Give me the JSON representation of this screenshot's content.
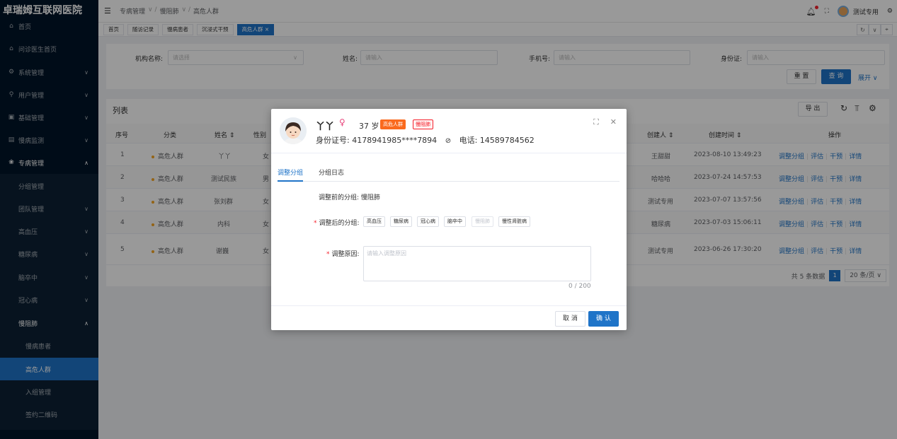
{
  "app": {
    "title": "卓瑞姆互联网医院"
  },
  "sidebar": {
    "items": [
      {
        "label": "首页",
        "icon": "home-icon"
      },
      {
        "label": "问诊医生首页",
        "icon": "home-icon"
      },
      {
        "label": "系统管理",
        "icon": "gear-icon"
      },
      {
        "label": "用户管理",
        "icon": "user-icon"
      },
      {
        "label": "基础管理",
        "icon": "grid-icon"
      },
      {
        "label": "慢病监测",
        "icon": "grid-icon"
      },
      {
        "label": "专病管理",
        "icon": "asterisk-icon"
      },
      {
        "label": "分组管理"
      },
      {
        "label": "团队管理"
      },
      {
        "label": "高血压"
      },
      {
        "label": "糖尿病"
      },
      {
        "label": "脑卒中"
      },
      {
        "label": "冠心病"
      },
      {
        "label": "慢阻肺"
      },
      {
        "label": "慢病患者"
      },
      {
        "label": "高危人群"
      },
      {
        "label": "入组管理"
      },
      {
        "label": "签约二维码"
      }
    ]
  },
  "header": {
    "breadcrumb": [
      "专病管理",
      "慢阻肺",
      "高危人群"
    ],
    "user_name": "测试专用"
  },
  "tabs": [
    {
      "label": "首页"
    },
    {
      "label": "随访记录"
    },
    {
      "label": "慢病患者"
    },
    {
      "label": "沉浸式干预"
    },
    {
      "label": "高危人群 ×"
    }
  ],
  "filter": {
    "org_label": "机构名称:",
    "org_placeholder": "请选择",
    "name_label": "姓名:",
    "name_placeholder": "请输入",
    "phone_label": "手机号:",
    "phone_placeholder": "请输入",
    "idcard_label": "身份证:",
    "idcard_placeholder": "请输入",
    "reset": "重 置",
    "search": "查 询",
    "expand": "展开 ∨"
  },
  "list": {
    "title": "列表",
    "export": "导 出",
    "columns": [
      "序号",
      "分类",
      "姓名 ⇕",
      "性别",
      "创建人 ⇕",
      "创建时间 ⇕",
      "操作"
    ],
    "rows": [
      {
        "no": "1",
        "category": "高危人群",
        "name": "丫丫",
        "gender": "女",
        "creator": "王甜甜",
        "time": "2023-08-10 13:49:23"
      },
      {
        "no": "2",
        "category": "高危人群",
        "name": "测试民族",
        "gender": "男",
        "creator": "哈哈哈",
        "time": "2023-07-24 14:57:53"
      },
      {
        "no": "3",
        "category": "高危人群",
        "name": "张刘群",
        "gender": "女",
        "creator": "测试专用",
        "time": "2023-07-07 13:57:56"
      },
      {
        "no": "4",
        "category": "高危人群",
        "name": "内科",
        "gender": "女",
        "creator": "糖尿病",
        "time": "2023-07-03 15:06:11"
      },
      {
        "no": "5",
        "category": "高危人群",
        "name": "谢巍",
        "gender": "女",
        "creator": "测试专用",
        "time": "2023-06-26 17:30:20"
      }
    ],
    "ops": [
      "调整分组",
      "评估",
      "干预",
      "详情"
    ],
    "total": "共 5 条数据",
    "page": "1",
    "page_size": "20 条/页 ∨"
  },
  "modal": {
    "name": "丫丫",
    "age": "37 岁",
    "tag1": "高危人群",
    "tag2": "慢阻肺",
    "id_text": "身份证号: 4178941985****7894",
    "phone_text": "电话: 14589784562",
    "tab_adjust": "调整分组",
    "tab_log": "分组日志",
    "before_label": "调整前的分组:",
    "before_value": "慢阻肺",
    "after_label": "调整后的分组:",
    "groups": [
      {
        "label": "高血压",
        "disabled": false
      },
      {
        "label": "糖尿病",
        "disabled": false
      },
      {
        "label": "冠心病",
        "disabled": false
      },
      {
        "label": "脑卒中",
        "disabled": false
      },
      {
        "label": "慢阻肺",
        "disabled": true
      },
      {
        "label": "慢性肾脏病",
        "disabled": false
      }
    ],
    "reason_label": "调整原因:",
    "reason_placeholder": "请输入调整原因",
    "count": "0 / 200",
    "cancel": "取 消",
    "confirm": "确 认"
  },
  "colors": {
    "accent": "#1f74c8",
    "sidebar_bg": "#001529",
    "tag_orange": "#fa6a1e",
    "tag_red": "#f5222d"
  }
}
